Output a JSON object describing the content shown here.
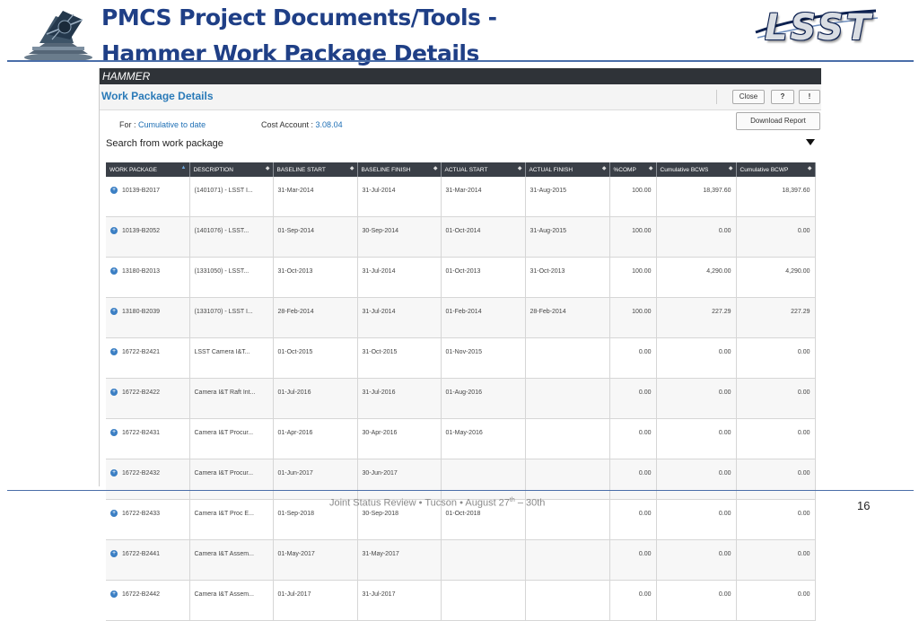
{
  "slide": {
    "title_line1": "PMCS Project Documents/Tools -",
    "title_line2": "Hammer Work Package Details",
    "logo_text": "LSST",
    "footer_main": "Joint Status Review • Tucson  • August 27",
    "footer_sup": "th",
    "footer_end": " – 30th",
    "page_number": "16"
  },
  "app": {
    "header": "HAMMER",
    "title": "Work Package Details",
    "buttons": {
      "close": "Close",
      "help": "?",
      "info": "!"
    },
    "for_label": "For :",
    "for_value": "Cumulative to date",
    "cost_label": "Cost Account :",
    "cost_value": "3.08.04",
    "download": "Download Report",
    "search_label": "Search from work package"
  },
  "table": {
    "columns": [
      "WORK PACKAGE",
      "DESCRIPTION",
      "BASELINE START",
      "BASELINE FINISH",
      "ACTUAL START",
      "ACTUAL FINISH",
      "%COMP",
      "Cumulative BCWS",
      "Cumulative BCWP"
    ],
    "rows": [
      [
        "10139-B2017",
        "(1401071) - LSST I...",
        "31-Mar-2014",
        "31-Jul-2014",
        "31-Mar-2014",
        "31-Aug-2015",
        "100.00",
        "18,397.60",
        "18,397.60"
      ],
      [
        "10139-B2052",
        "(1401076) - LSST...",
        "01-Sep-2014",
        "30-Sep-2014",
        "01-Oct-2014",
        "31-Aug-2015",
        "100.00",
        "0.00",
        "0.00"
      ],
      [
        "13180-B2013",
        "(1331050) - LSST...",
        "31-Oct-2013",
        "31-Jul-2014",
        "01-Oct-2013",
        "31-Oct-2013",
        "100.00",
        "4,290.00",
        "4,290.00"
      ],
      [
        "13180-B2039",
        "(1331070) - LSST I...",
        "28-Feb-2014",
        "31-Jul-2014",
        "01-Feb-2014",
        "28-Feb-2014",
        "100.00",
        "227.29",
        "227.29"
      ],
      [
        "16722-B2421",
        "LSST Camera I&T...",
        "01-Oct-2015",
        "31-Oct-2015",
        "01-Nov-2015",
        "",
        "0.00",
        "0.00",
        "0.00"
      ],
      [
        "16722-B2422",
        "Camera I&T Raft Int...",
        "01-Jul-2016",
        "31-Jul-2016",
        "01-Aug-2016",
        "",
        "0.00",
        "0.00",
        "0.00"
      ],
      [
        "16722-B2431",
        "Camera I&T Procur...",
        "01-Apr-2016",
        "30-Apr-2016",
        "01-May-2016",
        "",
        "0.00",
        "0.00",
        "0.00"
      ],
      [
        "16722-B2432",
        "Camera I&T Procur...",
        "01-Jun-2017",
        "30-Jun-2017",
        "",
        "",
        "0.00",
        "0.00",
        "0.00"
      ],
      [
        "16722-B2433",
        "Camera I&T Proc E...",
        "01-Sep-2018",
        "30-Sep-2018",
        "01-Oct-2018",
        "",
        "0.00",
        "0.00",
        "0.00"
      ],
      [
        "16722-B2441",
        "Camera I&T Assem...",
        "01-May-2017",
        "31-May-2017",
        "",
        "",
        "0.00",
        "0.00",
        "0.00"
      ],
      [
        "16722-B2442",
        "Camera I&T Assem...",
        "01-Jul-2017",
        "31-Jul-2017",
        "",
        "",
        "0.00",
        "0.00",
        "0.00"
      ]
    ]
  }
}
